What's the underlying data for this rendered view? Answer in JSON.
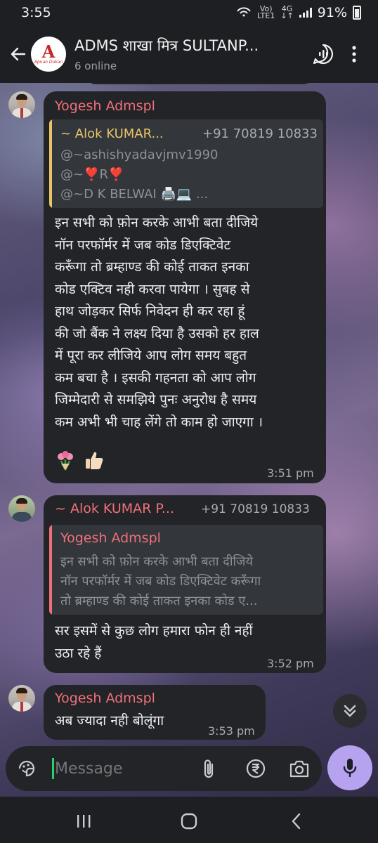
{
  "status_bar": {
    "time": "3:55",
    "network_top": "Vo)",
    "network_bottom": "LTE1",
    "network_type": "4G",
    "battery": "91%",
    "icons": [
      "hotspot-icon",
      "signal-icon",
      "battery-icon"
    ]
  },
  "header": {
    "title": "ADMS शाखा मित्र SULTANP...",
    "subtitle": "6 online",
    "avatar_text": "A",
    "avatar_caption": "Apnan Dukan",
    "icons": [
      "back-arrow-icon",
      "voice-chat-icon",
      "more-vert-icon"
    ]
  },
  "messages": [
    {
      "sender": "Yogesh Admspl",
      "reply": {
        "sender": "~ Alok KUMAR...",
        "phone": "+91 70819 10833",
        "lines": [
          "@~ashishyadavjmv1990",
          "@~❣️R❣️",
          "@~D K BELWAI 🖨️💻 ..."
        ]
      },
      "lines": [
        "इन सभी को फ़ोन करके आभी बता दीजिये",
        "नॉन परफॉर्मर में जब कोड डिएक्टिवेट",
        "करूँगा तो ब्रम्हाण्ड की कोई ताकत इनका",
        "कोड एक्टिव नही करवा पायेगा । सुबह से",
        "हाथ जोड़कर सिर्फ निवेदन ही कर रहा हूं",
        "की जो बैंक ने लक्ष्य दिया है उसको हर हाल",
        "में पूरा कर लीजिये आप लोग समय बहुत",
        "कम बचा है । इसकी गहनता को आप लोग",
        "जिम्मेदारी से समझिये पुनः अनुरोध है समय",
        "कम अभी भी चाह लेंगे तो काम हो जाएगा ।"
      ],
      "emoji_icons": [
        "bouquet-icon",
        "thumbs-up-icon"
      ],
      "time": "3:51 pm"
    },
    {
      "sender": "~ Alok KUMAR P...",
      "phone": "+91 70819 10833",
      "reply": {
        "sender": "Yogesh Admspl",
        "lines": [
          "इन सभी को फ़ोन करके आभी बता दीजिये",
          "नॉन परफॉर्मर में जब कोड डिएक्टिवेट करूँगा",
          "तो ब्रम्हाण्ड की कोई ताकत इनका  कोड ए..."
        ]
      },
      "lines": [
        "सर इसमें से कुछ लोग हमारा फोन ही नहीं",
        "उठा रहे हैं"
      ],
      "time": "3:52 pm"
    },
    {
      "sender": "Yogesh Admspl",
      "lines": [
        "अब ज्यादा नही बोलूंगा"
      ],
      "time": "3:53 pm"
    }
  ],
  "input": {
    "placeholder": "Message",
    "icons": [
      "sticker-icon",
      "attach-icon",
      "rupee-icon",
      "camera-icon",
      "mic-icon"
    ]
  },
  "nav": {
    "icons": [
      "recents-icon",
      "home-icon",
      "back-icon"
    ]
  },
  "colors": {
    "bubble": "#232427",
    "sender": "#f0707a",
    "reply_bar_1": "#e9c46a",
    "reply_bar_2": "#f0707a",
    "mic_button": "#b7a2f0",
    "cursor": "#25d366"
  }
}
